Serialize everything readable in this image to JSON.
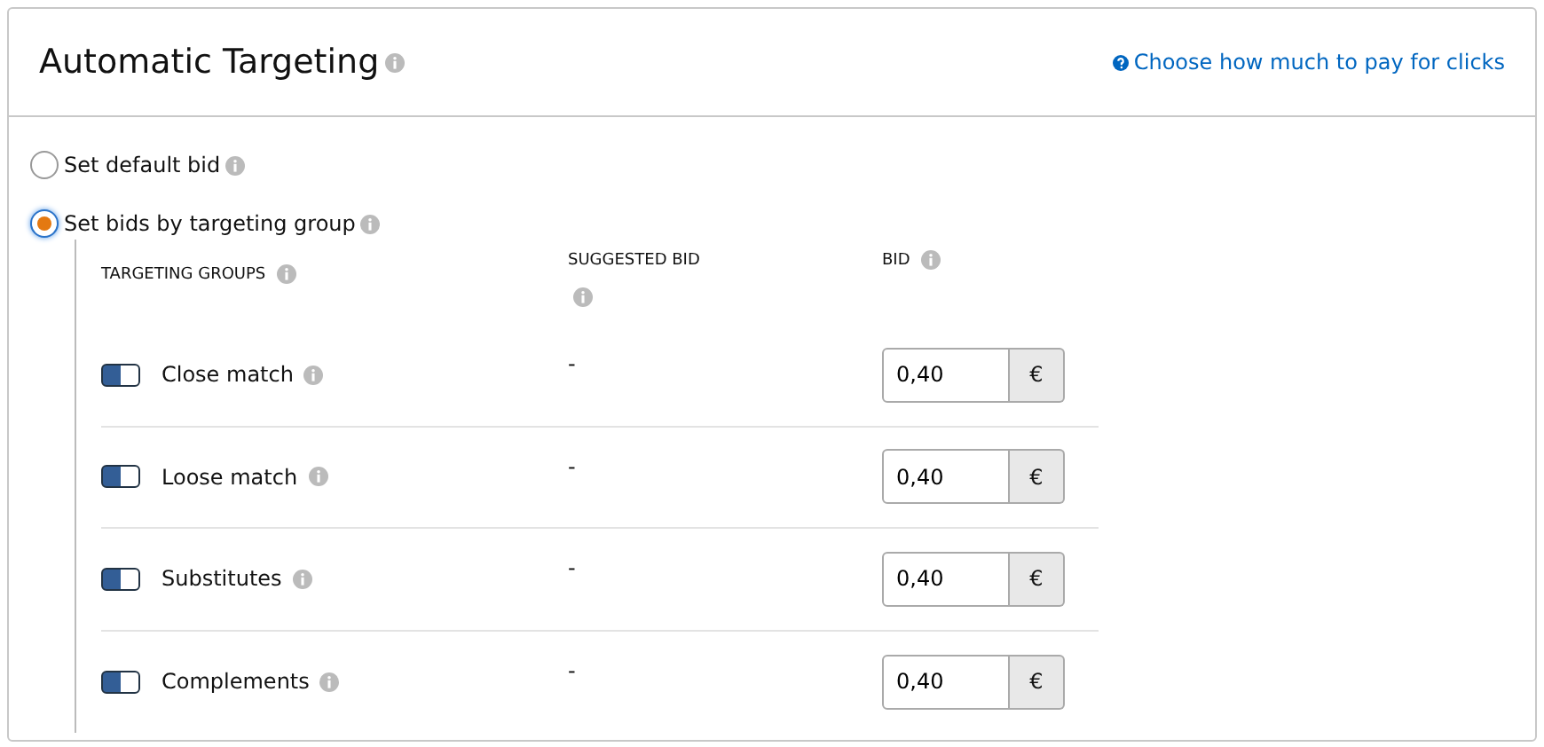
{
  "title": "Automatic Targeting",
  "help_link": "Choose how much to pay for clicks",
  "bid_options": [
    {
      "label": "Set default bid",
      "selected": false
    },
    {
      "label": "Set bids by targeting group",
      "selected": true
    }
  ],
  "table": {
    "columns": [
      "TARGETING GROUPS",
      "SUGGESTED BID",
      "BID"
    ],
    "rows": [
      {
        "name": "Close match",
        "on": true,
        "suggested_bid": "-",
        "bid": "0,40",
        "currency": "€"
      },
      {
        "name": "Loose match",
        "on": true,
        "suggested_bid": "-",
        "bid": "0,40",
        "currency": "€"
      },
      {
        "name": "Substitutes",
        "on": true,
        "suggested_bid": "-",
        "bid": "0,40",
        "currency": "€"
      },
      {
        "name": "Complements",
        "on": true,
        "suggested_bid": "-",
        "bid": "0,40",
        "currency": "€"
      }
    ]
  }
}
